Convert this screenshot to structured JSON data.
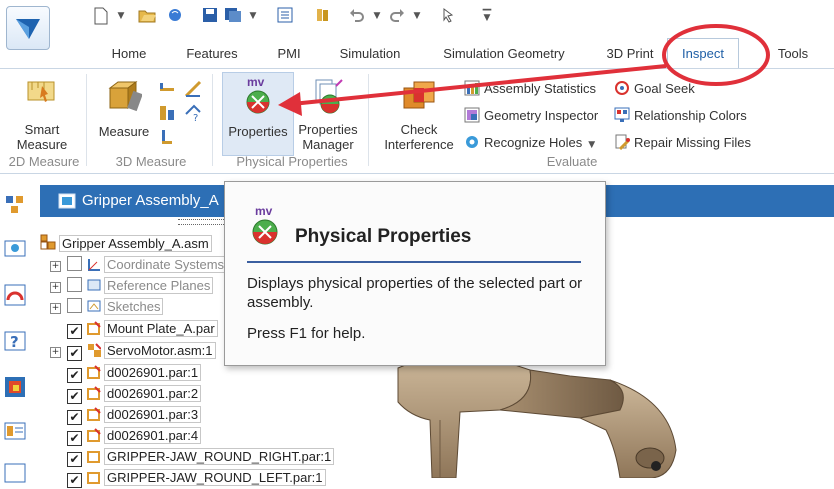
{
  "tabs": [
    "Home",
    "Features",
    "PMI",
    "Simulation",
    "Simulation Geometry",
    "3D Print",
    "Inspect",
    "Tools"
  ],
  "active_tab": "Inspect",
  "ribbon": {
    "smart_measure": [
      "Smart",
      "Measure"
    ],
    "measure": "Measure",
    "properties": "Properties",
    "properties_manager": [
      "Properties",
      "Manager"
    ],
    "check_interference": [
      "Check",
      "Interference"
    ],
    "assembly_statistics": "Assembly Statistics",
    "geometry_inspector": "Geometry Inspector",
    "recognize_holes": "Recognize Holes",
    "goal_seek": "Goal Seek",
    "relationship_colors": "Relationship Colors",
    "repair_missing_files": "Repair Missing Files",
    "groups": {
      "measure_2d": "2D Measure",
      "measure_3d": "3D Measure",
      "physical_properties": "Physical Properties",
      "evaluate": "Evaluate"
    }
  },
  "pathfinder": {
    "title": "Gripper Assembly_A",
    "items": [
      {
        "label": "Gripper Assembly_A.asm",
        "level": 0
      },
      {
        "label": "Coordinate Systems",
        "level": 1
      },
      {
        "label": "Reference Planes",
        "level": 1
      },
      {
        "label": "Sketches",
        "level": 1
      },
      {
        "label": "Mount Plate_A.par",
        "level": 1
      },
      {
        "label": "ServoMotor.asm:1",
        "level": 1
      },
      {
        "label": "d0026901.par:1",
        "level": 1
      },
      {
        "label": "d0026901.par:2",
        "level": 1
      },
      {
        "label": "d0026901.par:3",
        "level": 1
      },
      {
        "label": "d0026901.par:4",
        "level": 1
      },
      {
        "label": "GRIPPER-JAW_ROUND_RIGHT.par:1",
        "level": 1
      },
      {
        "label": "GRIPPER-JAW_ROUND_LEFT.par:1",
        "level": 1
      }
    ]
  },
  "tooltip": {
    "badge": "mv",
    "title": "Physical Properties",
    "description": "Displays physical properties of the selected part or assembly.",
    "help": "Press F1 for help."
  },
  "colors": {
    "accent": "#2d6fb5",
    "annotation": "#e0303a"
  }
}
